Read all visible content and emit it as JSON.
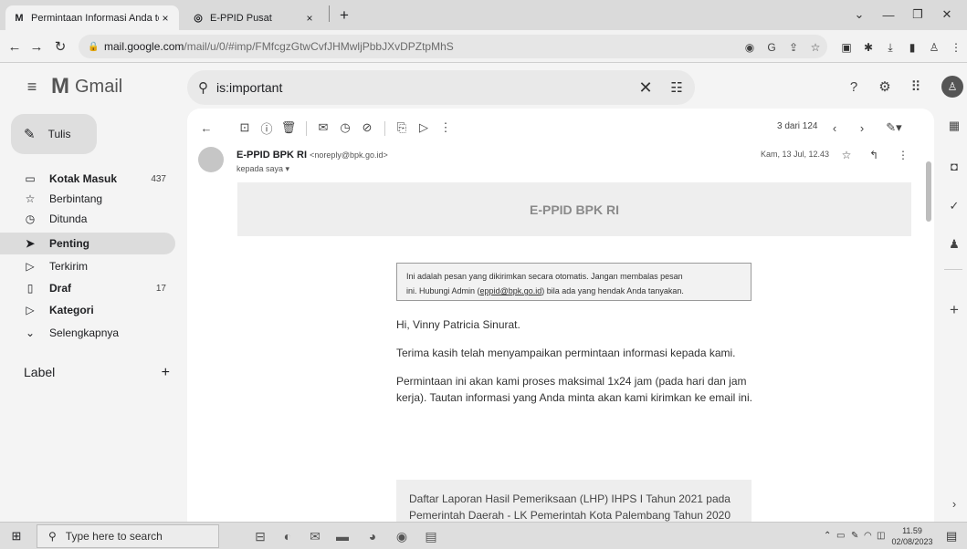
{
  "browser": {
    "tabs": [
      {
        "title": "Permintaan Informasi Anda telah",
        "icon": "gmail-icon",
        "close": "×"
      },
      {
        "title": "E-PPID Pusat",
        "icon": "globe-icon",
        "close": "×"
      }
    ],
    "new_tab": "+",
    "window_controls": {
      "collapse": "⌄",
      "minimize": "—",
      "restore": "❐",
      "close": "✕"
    },
    "url_host": "mail.google.com",
    "url_path": "/mail/u/0/#imp/FMfcgzGtwCvfJHMwljPbbJXvDPZtpMhS"
  },
  "gmail": {
    "logo_text": "Gmail",
    "search_query": "is:important",
    "compose_label": "Tulis",
    "nav": [
      {
        "label": "Kotak Masuk",
        "count": "437",
        "icon": "inbox-icon",
        "bold": true
      },
      {
        "label": "Berbintang",
        "count": "",
        "icon": "star-icon",
        "bold": false
      },
      {
        "label": "Ditunda",
        "count": "",
        "icon": "clock-icon",
        "bold": false
      },
      {
        "label": "Penting",
        "count": "",
        "icon": "important-icon",
        "bold": true
      },
      {
        "label": "Terkirim",
        "count": "",
        "icon": "send-icon",
        "bold": false
      },
      {
        "label": "Draf",
        "count": "17",
        "icon": "draft-icon",
        "bold": true
      },
      {
        "label": "Kategori",
        "count": "",
        "icon": "label-icon",
        "bold": true
      },
      {
        "label": "Selengkapnya",
        "count": "",
        "icon": "chevron-down-icon",
        "bold": false
      }
    ],
    "label_heading": "Label",
    "label_add": "+",
    "pager": "3 dari 124"
  },
  "message": {
    "sender_name": "E-PPID BPK RI",
    "sender_email": "<noreply@bpk.go.id>",
    "recipient": "kepada saya ▾",
    "date": "Kam, 13 Jul, 12.43",
    "header_title": "E-PPID BPK RI",
    "notice_line1": "Ini adalah pesan yang dikirimkan secara otomatis. Jangan membalas pesan",
    "notice_line2_pre": "ini. Hubungi Admin (",
    "notice_link": "eppid@bpk.go.id",
    "notice_line2_post": ") bila ada yang hendak Anda tanyakan.",
    "greeting": "Hi, Vinny Patricia Sinurat.",
    "p1": "Terima kasih telah menyampaikan permintaan informasi kepada kami.",
    "p2": "Permintaan ini akan kami proses maksimal 1x24 jam (pada hari dan jam kerja). Tautan informasi yang Anda minta akan kami kirimkan ke email ini.",
    "request": "Daftar Laporan Hasil Pemeriksaan (LHP) IHPS I Tahun 2021 pada Pemerintah Daerah - LK Pemerintah Kota Palembang Tahun 2020"
  },
  "taskbar": {
    "search_placeholder": "Type here to search",
    "time": "11.59",
    "date": "02/08/2023"
  }
}
